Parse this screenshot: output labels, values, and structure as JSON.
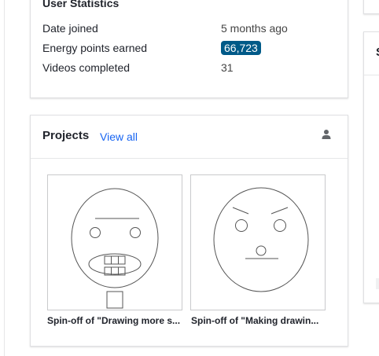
{
  "user_statistics": {
    "title": "User Statistics",
    "rows": [
      {
        "label": "Date joined",
        "value": "5 months ago"
      },
      {
        "label": "Energy points earned",
        "value": "66,723"
      },
      {
        "label": "Videos completed",
        "value": "31"
      }
    ],
    "badge_color": "#005a88"
  },
  "projects": {
    "title": "Projects",
    "view_all_label": "View all",
    "header_icon": "person-icon",
    "link_color": "#1865f2",
    "items": [
      {
        "caption": "Spin-off of \"Drawing more s..."
      },
      {
        "caption": "Spin-off of \"Making drawin..."
      }
    ]
  },
  "right_panel": {
    "title_partial": "S"
  }
}
